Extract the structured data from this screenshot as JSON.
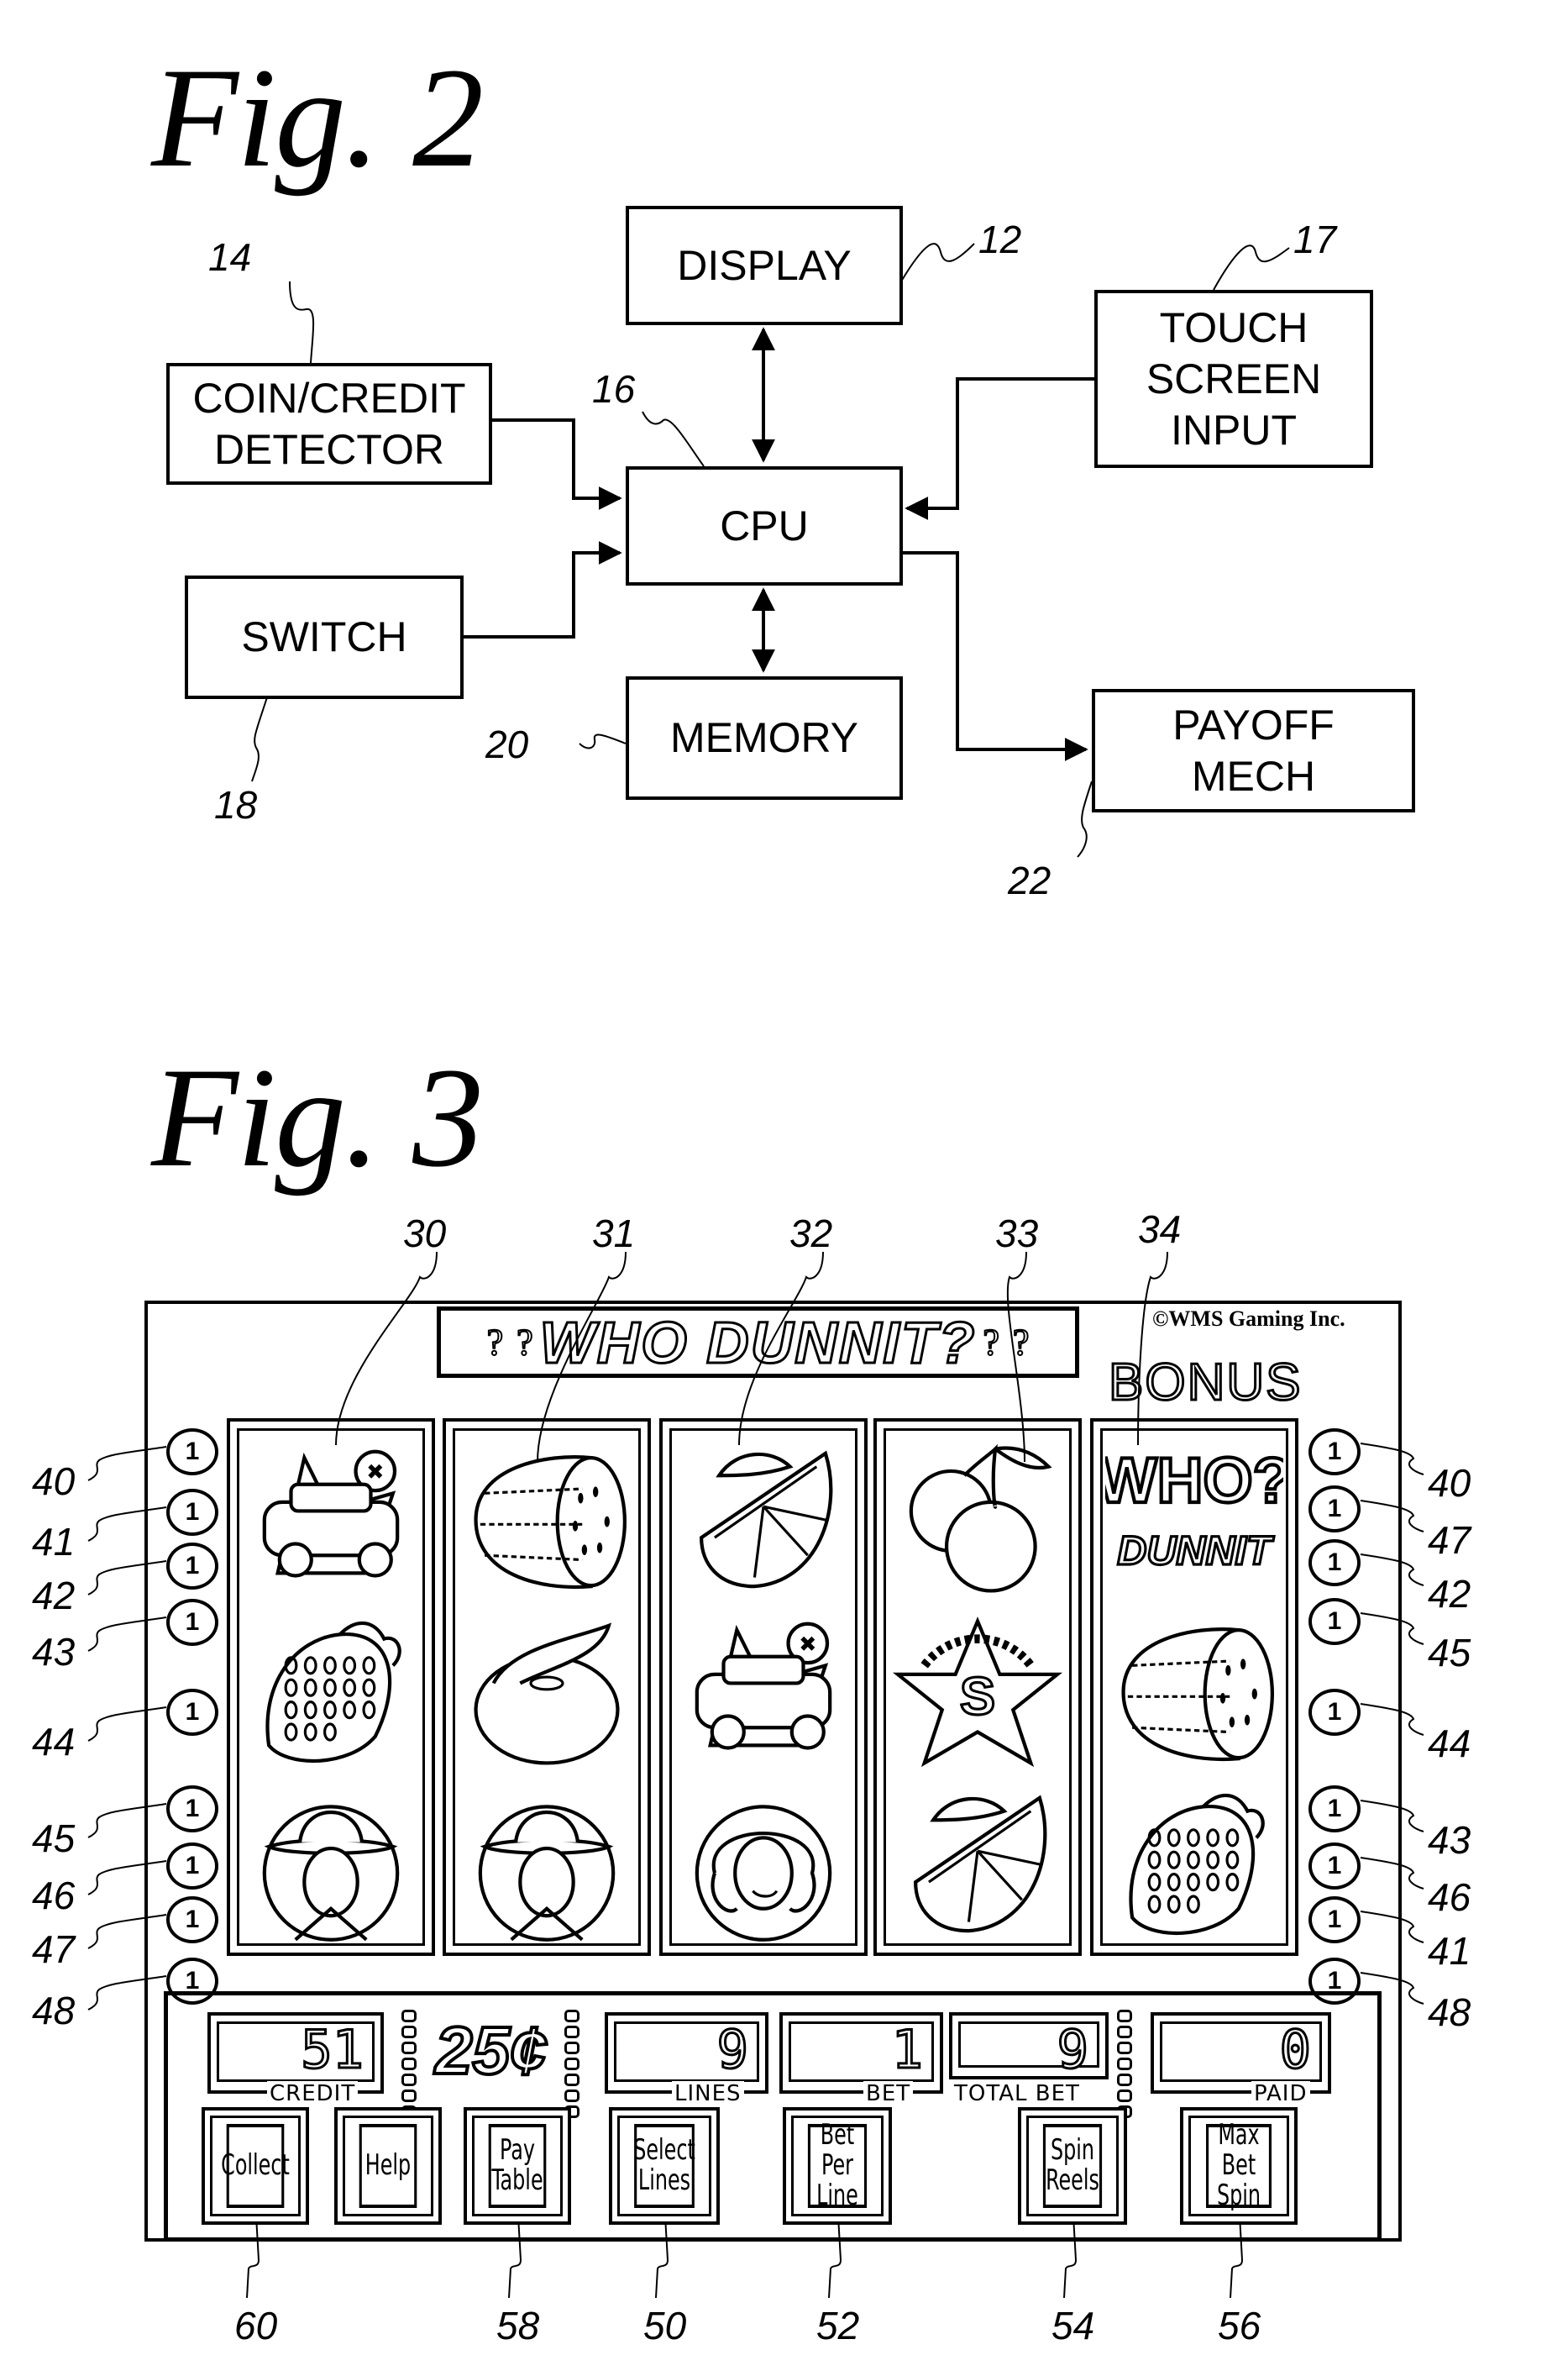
{
  "fig2": {
    "title": "Fig. 2",
    "blocks": {
      "display": {
        "label": "DISPLAY",
        "ref": "12"
      },
      "touch_screen_input": {
        "label": "TOUCH SCREEN INPUT",
        "ref": "17"
      },
      "coin_credit_detector": {
        "label": "COIN/CREDIT DETECTOR",
        "ref": "14"
      },
      "cpu": {
        "label": "CPU",
        "ref": "16"
      },
      "switch": {
        "label": "SWITCH",
        "ref": "18"
      },
      "memory": {
        "label": "MEMORY",
        "ref": "20"
      },
      "payoff_mech": {
        "label": "PAYOFF MECH",
        "ref": "22"
      }
    },
    "connections": [
      {
        "from": "display",
        "to": "cpu",
        "type": "bidirectional"
      },
      {
        "from": "cpu",
        "to": "memory",
        "type": "bidirectional"
      },
      {
        "from": "coin_credit_detector",
        "to": "cpu",
        "type": "arrow"
      },
      {
        "from": "switch",
        "to": "cpu",
        "type": "arrow"
      },
      {
        "from": "touch_screen_input",
        "to": "cpu",
        "type": "arrow"
      },
      {
        "from": "cpu",
        "to": "payoff_mech",
        "type": "arrow"
      }
    ]
  },
  "fig3": {
    "title": "Fig. 3",
    "game_title": "WHO DUNNIT?",
    "copyright": "©WMS Gaming Inc.",
    "bonus_label": "BONUS",
    "reel_refs": [
      "30",
      "31",
      "32",
      "33",
      "34"
    ],
    "reels": [
      {
        "ref": "30",
        "symbols": [
          "police-car",
          "strawberry",
          "detective"
        ]
      },
      {
        "ref": "31",
        "symbols": [
          "watermelon",
          "plum",
          "detective"
        ]
      },
      {
        "ref": "32",
        "symbols": [
          "orange-slice",
          "police-car",
          "woman"
        ]
      },
      {
        "ref": "33",
        "symbols": [
          "cherries",
          "sheriff-badge",
          "orange-slice"
        ]
      },
      {
        "ref": "34",
        "symbols": [
          "who-dunnit-bonus",
          "watermelon",
          "strawberry"
        ]
      }
    ],
    "payline_marker_text": "1",
    "left_payline_refs": [
      "40",
      "41",
      "42",
      "43",
      "44",
      "45",
      "46",
      "47",
      "48"
    ],
    "right_payline_refs": [
      "40",
      "47",
      "42",
      "45",
      "44",
      "43",
      "46",
      "41",
      "48"
    ],
    "denomination": "25¢",
    "meters": {
      "credit": {
        "label": "CREDIT",
        "value": "51"
      },
      "lines": {
        "label": "LINES",
        "value": "9"
      },
      "bet": {
        "label": "BET",
        "value": "1"
      },
      "total_bet": {
        "label": "TOTAL BET",
        "value": "9"
      },
      "paid": {
        "label": "PAID",
        "value": "0"
      }
    },
    "buttons": [
      {
        "id": "collect",
        "label": "Collect",
        "ref": "60"
      },
      {
        "id": "help",
        "label": "Help",
        "ref": ""
      },
      {
        "id": "pay-table",
        "label": "Pay\nTable",
        "ref": "58"
      },
      {
        "id": "select-lines",
        "label": "Select\nLines",
        "ref": "50"
      },
      {
        "id": "bet-per-line",
        "label": "Bet Per\nLine",
        "ref": "52"
      },
      {
        "id": "spin-reels",
        "label": "Spin\nReels",
        "ref": "54"
      },
      {
        "id": "max-bet-spin",
        "label": "Max Bet\nSpin",
        "ref": "56"
      }
    ]
  }
}
